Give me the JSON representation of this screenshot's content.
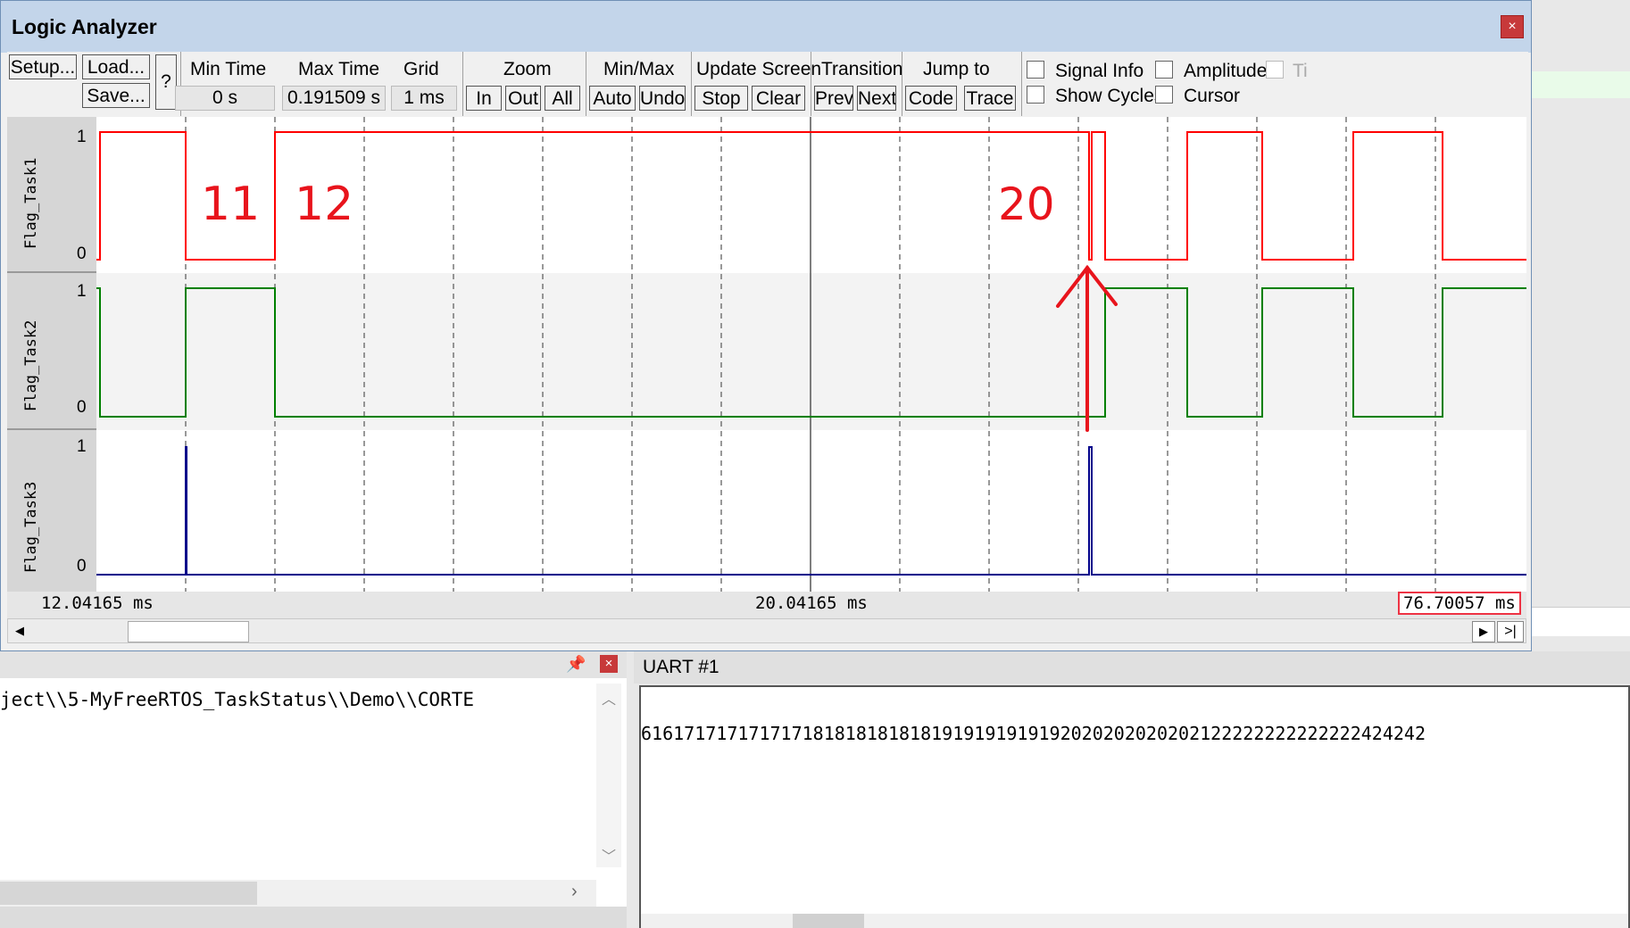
{
  "window": {
    "title": "Logic Analyzer",
    "close_glyph": "×"
  },
  "toolbar": {
    "setup": "Setup...",
    "load": "Load...",
    "save": "Save...",
    "help": "?",
    "min_time_label": "Min Time",
    "min_time_value": "0 s",
    "max_time_label": "Max Time",
    "max_time_value": "0.191509 s",
    "grid_label": "Grid",
    "grid_value": "1 ms",
    "zoom_label": "Zoom",
    "zoom_in": "In",
    "zoom_out": "Out",
    "zoom_all": "All",
    "minmax_label": "Min/Max",
    "minmax_auto": "Auto",
    "minmax_undo": "Undo",
    "update_label": "Update Screen",
    "update_stop": "Stop",
    "update_clear": "Clear",
    "transition_label": "Transition",
    "transition_prev": "Prev",
    "transition_next": "Next",
    "jump_label": "Jump to",
    "jump_code": "Code",
    "jump_trace": "Trace",
    "signal_info": "Signal Info",
    "show_cycles": "Show Cycles",
    "amplitude": "Amplitude",
    "cursor": "Cursor",
    "truncated": "Ti"
  },
  "signals": [
    {
      "name": "Flag_Task1",
      "high": "1",
      "low": "0",
      "color": "#ff0000"
    },
    {
      "name": "Flag_Task2",
      "high": "1",
      "low": "0",
      "color": "#008000"
    },
    {
      "name": "Flag_Task3",
      "high": "1",
      "low": "0",
      "color": "#00008b"
    }
  ],
  "time_axis": {
    "left": "12.04165 ms",
    "center": "20.04165 ms",
    "right": "76.70057 ms"
  },
  "annotations": {
    "a1": "11",
    "a2": "12",
    "a3": "20"
  },
  "left_panel": {
    "pin_icon": "pin-icon",
    "path_text": "ject\\\\5-MyFreeRTOS_TaskStatus\\\\Demo\\\\CORTE"
  },
  "uart": {
    "title": "UART #1",
    "text": "6161717171717171818181818181919191919192020202020202122222222222222424242"
  },
  "colors": {
    "task1": "#ff0000",
    "task2": "#008000",
    "task3": "#00008b",
    "annotation": "#e8141c"
  }
}
